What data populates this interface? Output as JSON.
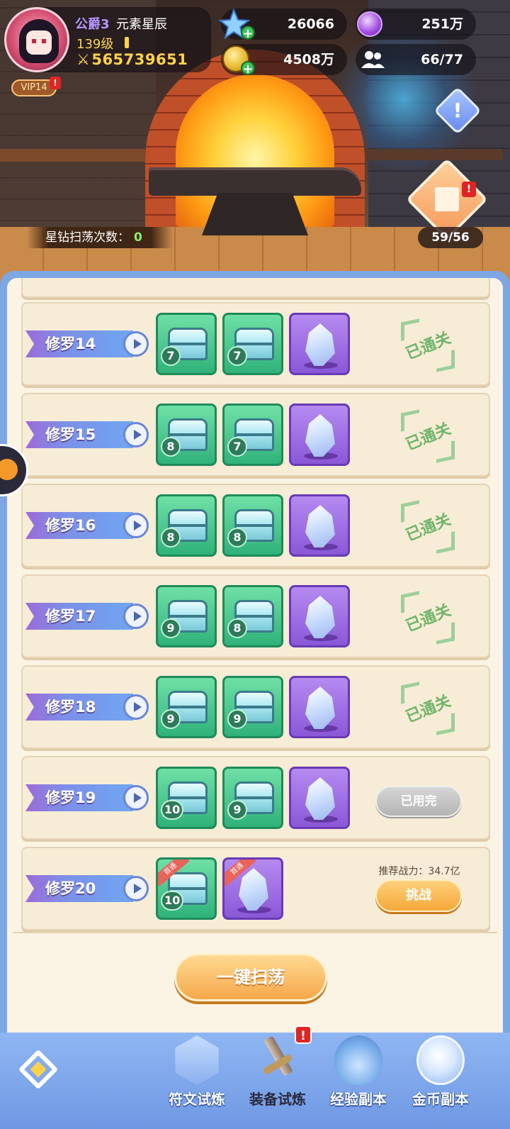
{
  "player": {
    "rank": "公爵3",
    "server": "元素星辰",
    "level": "139级",
    "power": "565739651",
    "vip": "VIP14",
    "vip_alert": "!"
  },
  "resources": {
    "star_gems": "26066",
    "purple_currency": "251万",
    "gold": "4508万",
    "members": "66/77"
  },
  "side_buttons": {
    "alert_symbol": "!",
    "gift_alert": "!",
    "gift_count": "59/56"
  },
  "sweep_counter": {
    "label": "星钻扫荡次数：",
    "value": "0"
  },
  "stages": [
    {
      "name": "修罗14",
      "rewards": [
        "7",
        "7"
      ],
      "status": "已通关"
    },
    {
      "name": "修罗15",
      "rewards": [
        "8",
        "7"
      ],
      "status": "已通关"
    },
    {
      "name": "修罗16",
      "rewards": [
        "8",
        "8"
      ],
      "status": "已通关"
    },
    {
      "name": "修罗17",
      "rewards": [
        "9",
        "8"
      ],
      "status": "已通关"
    },
    {
      "name": "修罗18",
      "rewards": [
        "9",
        "9"
      ],
      "status": "已通关"
    },
    {
      "name": "修罗19",
      "rewards": [
        "10",
        "9"
      ],
      "status": "已用完"
    },
    {
      "name": "修罗20",
      "rewards": [
        "10"
      ],
      "first_clear_tag": "首通",
      "recommended_power": "推荐战力：34.7亿",
      "action": "挑战"
    }
  ],
  "one_click_sweep": "一键扫荡",
  "nav": {
    "items": [
      "符文试炼",
      "装备试炼",
      "经验副本",
      "金币副本"
    ],
    "active": "装备试炼",
    "alert": "!"
  },
  "colors": {
    "panel_frame": "#7ea6e4",
    "panel_bg": "#fbf3e3",
    "cleared_stamp": "#6fb56a",
    "challenge": "#f5a83a"
  }
}
